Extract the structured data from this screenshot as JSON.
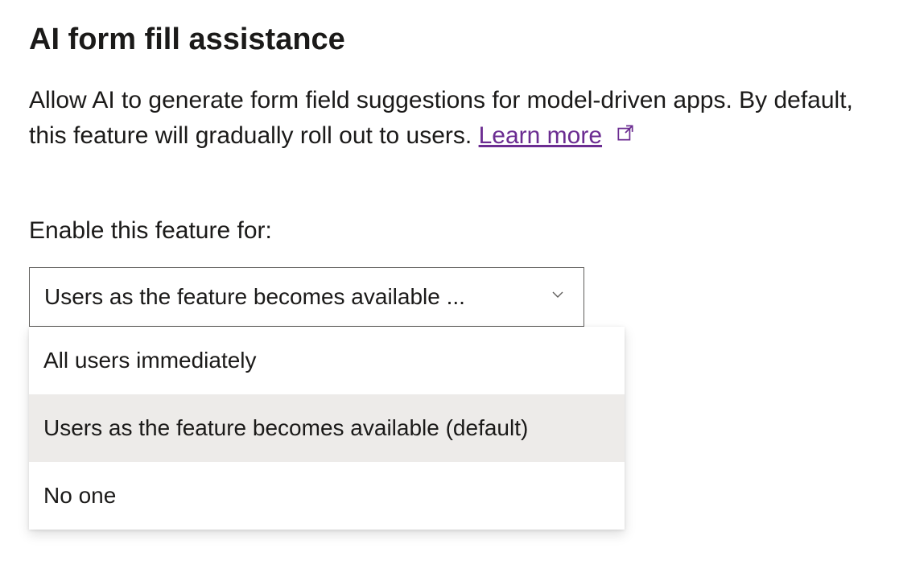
{
  "section": {
    "title": "AI form fill assistance",
    "description_pre": "Allow AI to generate form field suggestions for model-driven apps. By default, this feature will gradually roll out to users. ",
    "learn_more": "Learn more"
  },
  "field": {
    "label": "Enable this feature for:",
    "selected_display": "Users as the feature becomes available ...",
    "options": [
      "All users immediately",
      "Users as the feature becomes available (default)",
      "No one"
    ],
    "selected_index": 1
  }
}
